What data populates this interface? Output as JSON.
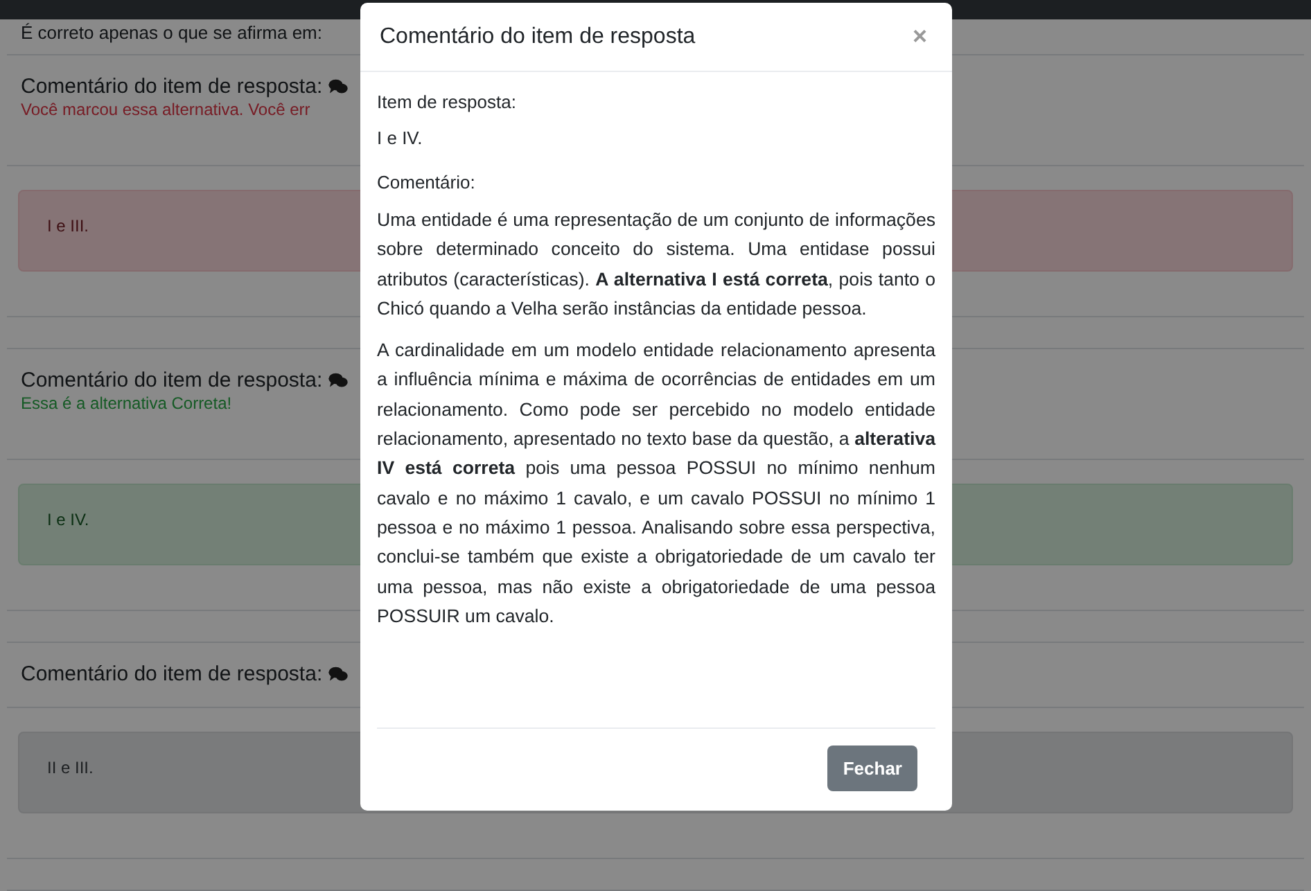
{
  "question_text": "É correto apenas o que se afirma em:",
  "sections": [
    {
      "heading": "Comentário do item de resposta:",
      "kind": "wrong",
      "message": "Você marcou essa alternativa. Você err",
      "alternative": {
        "text": "I e III.",
        "kind": "danger"
      }
    },
    {
      "heading": "Comentário do item de resposta:",
      "kind": "correct",
      "message": "Essa é a alternativa Correta!",
      "alternative": {
        "text": "I e IV.",
        "kind": "success"
      }
    },
    {
      "heading": "Comentário do item de resposta:",
      "kind": "none",
      "alternative": {
        "text": "II e III.",
        "kind": "secondary"
      }
    }
  ],
  "modal": {
    "title": "Comentário do item de resposta",
    "close": "×",
    "answer_label": "Item de resposta:",
    "answer": "I e IV.",
    "comment_label": "Comentário:",
    "paragraphs": [
      "Uma entidade é uma representação de um conjunto de informações sobre determinado conceito do sistema. Uma entidase possui atributos (características). **A alternativa I está correta**, pois tanto o Chicó quando a Velha serão instâncias da entidade pessoa.",
      "A cardinalidade em um modelo entidade relacionamento apresenta a influência mínima e máxima de ocorrências de entidades em um relacionamento. Como pode ser percebido no modelo entidade relacionamento, apresentado no texto base da questão, a **alterativa IV está correta** pois uma pessoa POSSUI no mínimo nenhum cavalo e no máximo 1 cavalo, e um cavalo POSSUI no mínimo 1 pessoa e no máximo 1 pessoa. Analisando sobre essa perspectiva, conclui-se também que existe a obrigatoriedade de um cavalo ter uma pessoa, mas não existe a obrigatoriedade de uma pessoa POSSUIR um cavalo."
    ],
    "button": "Fechar"
  }
}
